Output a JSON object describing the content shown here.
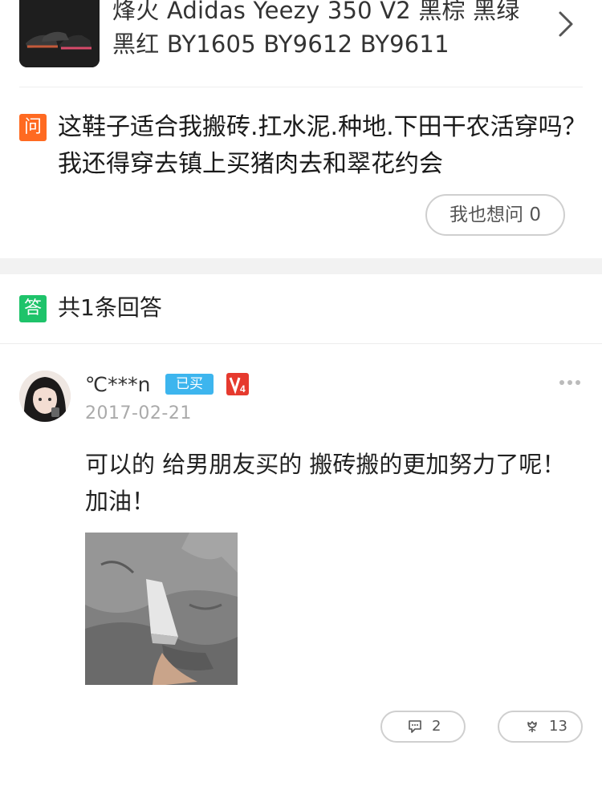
{
  "product": {
    "title": "烽火 Adidas Yeezy 350 V2 黑棕 黑绿 黑红 BY1605 BY9612 BY9611",
    "thumbnail_icon": "sneakers-thumbnail",
    "arrow_icon": "chevron-right-icon"
  },
  "question": {
    "badge": "问",
    "text": "这鞋子适合我搬砖.扛水泥.种地.下田干农活穿吗？我还得穿去镇上买猪肉去和翠花约会",
    "also_ask_label": "我也想问 0"
  },
  "answers": {
    "badge": "答",
    "count_label": "共1条回答",
    "items": [
      {
        "username": "℃***n",
        "bought_badge": "已买",
        "level_badge": "V4",
        "date": "2017-02-21",
        "text": "可以的 给男朋友买的 搬砖搬的更加努力了呢！加油！",
        "comments": "2",
        "likes": "13"
      }
    ]
  },
  "colors": {
    "question_badge": "#ff6a21",
    "answer_badge": "#1ec36a",
    "bought_badge": "#3db5ee",
    "level_badge": "#e63a2e"
  }
}
